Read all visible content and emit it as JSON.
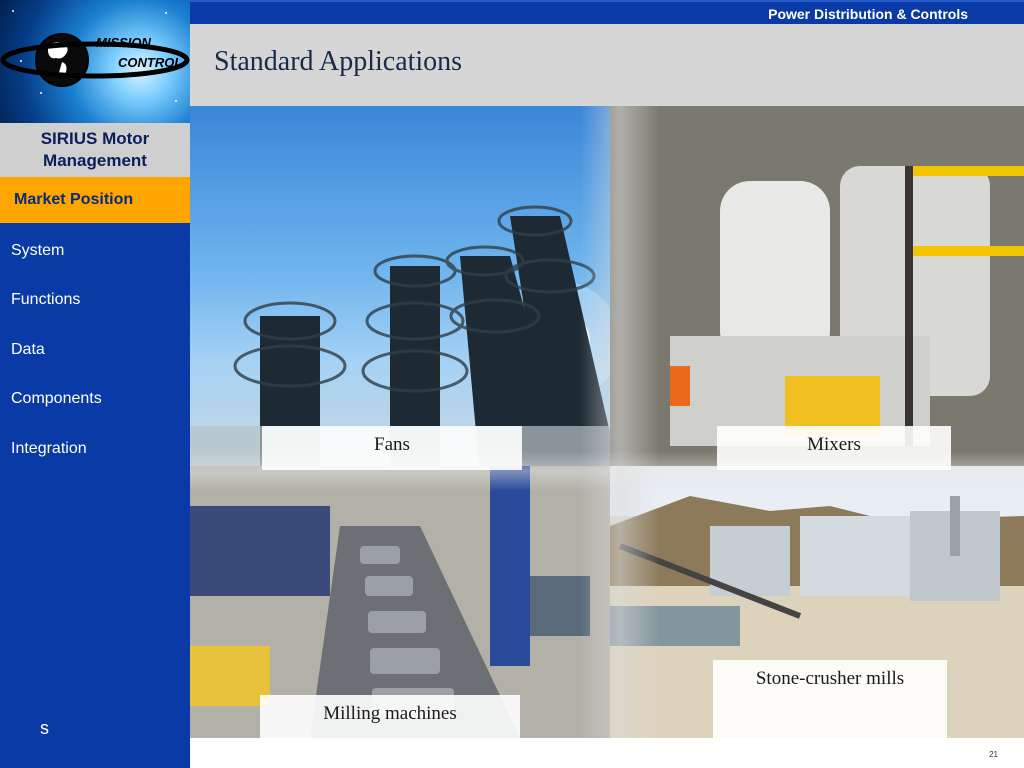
{
  "header": {
    "section": "Power Distribution & Controls",
    "title": "Standard Applications"
  },
  "logo": {
    "line1": "MISSION",
    "line2": "CONTROL"
  },
  "sidebar": {
    "product": "SIRIUS Motor Management",
    "active_item": "Market Position",
    "items": [
      {
        "label": "System"
      },
      {
        "label": "Functions"
      },
      {
        "label": "Data"
      },
      {
        "label": "Components"
      },
      {
        "label": "Integration"
      }
    ],
    "footer": "s"
  },
  "applications": [
    {
      "label": "Fans"
    },
    {
      "label": "Mixers"
    },
    {
      "label": "Stone-crusher mills"
    },
    {
      "label": "Milling machines"
    }
  ],
  "page_number": "21",
  "colors": {
    "sidebar_blue": "#0a3aa6",
    "active_orange": "#ffa500",
    "title_bar_gray": "#d6d6d6"
  }
}
